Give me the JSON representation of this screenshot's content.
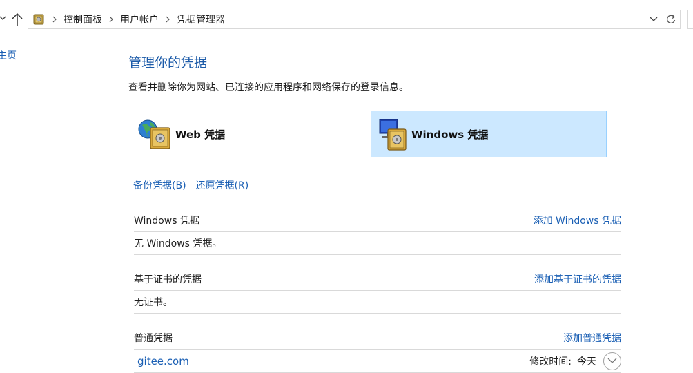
{
  "address_bar": {
    "breadcrumbs": [
      "控制面板",
      "用户帐户",
      "凭据管理器"
    ]
  },
  "left_panel": {
    "home_link": "控制面板主页",
    "home_link_visible": "主页"
  },
  "main": {
    "title": "管理你的凭据",
    "description": "查看并删除你为网站、已连接的应用程序和网络保存的登录信息。",
    "tiles": [
      {
        "label": "Web 凭据",
        "selected": false
      },
      {
        "label": "Windows 凭据",
        "selected": true
      }
    ],
    "backup_label": "备份凭据(B)",
    "restore_label": "还原凭据(R)",
    "sections": [
      {
        "title": "Windows 凭据",
        "action": "添加 Windows 凭据",
        "empty_text": "无 Windows 凭据。"
      },
      {
        "title": "基于证书的凭据",
        "action": "添加基于证书的凭据",
        "empty_text": "无证书。"
      },
      {
        "title": "普通凭据",
        "action": "添加普通凭据",
        "items": [
          {
            "name": "gitee.com",
            "modified_label": "修改时间:",
            "modified_value": "今天"
          }
        ]
      }
    ]
  },
  "colors": {
    "link": "#1a5fb4",
    "title": "#1b5aa8",
    "selected_tile_bg": "#cce8ff",
    "selected_tile_border": "#99d1ff"
  }
}
